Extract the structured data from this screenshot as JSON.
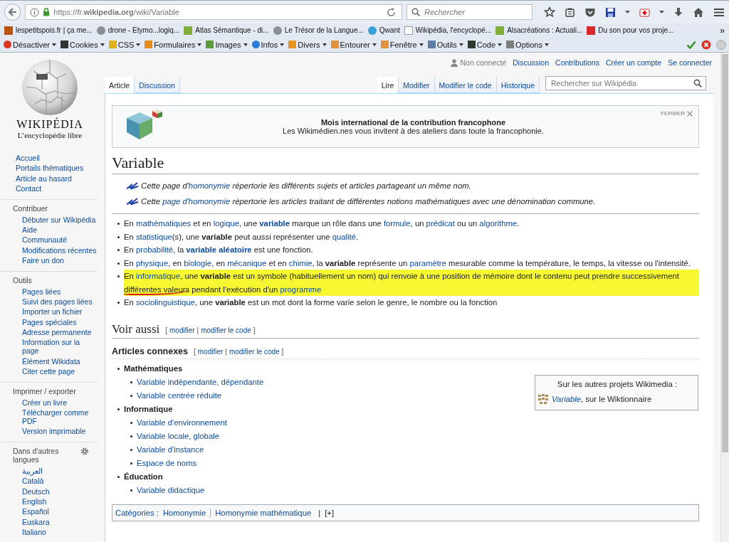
{
  "browser": {
    "url": "https://fr.**wikipedia.org**/wiki/Variable",
    "search_placeholder": "Rechercher",
    "bookmarks": [
      {
        "label": "lespetitspois.fr | ça me...",
        "kind": "tile"
      },
      {
        "label": "drone - Etymo...logiq...",
        "kind": "globe"
      },
      {
        "label": "Atlas Sémantique - di...",
        "kind": "sprout"
      },
      {
        "label": "Le Trésor de la Langue...",
        "kind": "globe"
      },
      {
        "label": "Qwant",
        "kind": "ring"
      },
      {
        "label": "Wikipédia, l'encyclopé...",
        "kind": "page"
      },
      {
        "label": "Alsacréations : Actuali...",
        "kind": "sprout"
      },
      {
        "label": "Du son pour vos proje...",
        "kind": "redtile"
      }
    ],
    "bookmarks_more": "»",
    "devtools": [
      {
        "label": "Désactiver",
        "kind": "block"
      },
      {
        "label": "Cookies",
        "kind": "person"
      },
      {
        "label": "CSS",
        "kind": "wand"
      },
      {
        "label": "Formulaires",
        "kind": "form"
      },
      {
        "label": "Images",
        "kind": "image"
      },
      {
        "label": "Infos",
        "kind": "info"
      },
      {
        "label": "Divers",
        "kind": "book"
      },
      {
        "label": "Entourer",
        "kind": "pencil"
      },
      {
        "label": "Fenêtre",
        "kind": "pencil"
      },
      {
        "label": "Outils",
        "kind": "tools"
      },
      {
        "label": "Code",
        "kind": "terminal"
      },
      {
        "label": "Options",
        "kind": "ruler"
      }
    ]
  },
  "sidebar": {
    "wordmark": "WIKIPÉDIA",
    "tagline": "L’encyclopédie libre",
    "groups": [
      {
        "items": [
          "Accueil",
          "Portails thématiques",
          "Article au hasard",
          "Contact"
        ]
      },
      {
        "heading": "Contribuer",
        "items": [
          "Débuter sur Wikipédia",
          "Aide",
          "Communauté",
          "Modifications récentes",
          "Faire un don"
        ]
      },
      {
        "heading": "Outils",
        "items": [
          "Pages liées",
          "Suivi des pages liées",
          "Importer un fichier",
          "Pages spéciales",
          "Adresse permanente",
          "Information sur la page",
          "Élément Wikidata",
          "Citer cette page"
        ]
      },
      {
        "heading": "Imprimer / exporter",
        "items": [
          "Créer un livre",
          "Télécharger comme PDF",
          "Version imprimable"
        ]
      },
      {
        "heading": "Dans d'autres langues",
        "gear": true,
        "items": [
          "العربية",
          "Català",
          "Deutsch",
          "English",
          "Español",
          "Euskara",
          "Italiano"
        ]
      }
    ]
  },
  "personal": {
    "status": "Non connecté",
    "links": [
      "Discussion",
      "Contributions",
      "Créer un compte",
      "Se connecter"
    ]
  },
  "tabs_left": [
    {
      "label": "Article",
      "selected": true
    },
    {
      "label": "Discussion",
      "selected": false
    }
  ],
  "tabs_right": [
    {
      "label": "Lire",
      "selected": true
    },
    {
      "label": "Modifier",
      "selected": false
    },
    {
      "label": "Modifier le code",
      "selected": false
    },
    {
      "label": "Historique",
      "selected": false
    }
  ],
  "search": {
    "placeholder": "Rechercher sur Wikipédia"
  },
  "banner": {
    "title": "Mois international de la contribution francophone",
    "text": "Les Wikimédien.nes vous invitent à des ateliers dans toute la francophonie.",
    "close": "FERMER"
  },
  "title": "Variable",
  "hatnotes": [
    [
      {
        "t": "Cette page d'"
      },
      {
        "t": "homonymie",
        "link": true
      },
      {
        "t": " répertorie les différents sujets et articles partageant un même nom."
      }
    ],
    [
      {
        "t": "Cette "
      },
      {
        "t": "page d'homonymie",
        "link": true
      },
      {
        "t": " répertorie les articles traitant de différentes notions mathématiques avec une dénomination commune."
      }
    ]
  ],
  "bullets": [
    {
      "highlighted": false,
      "segments": [
        {
          "t": "En "
        },
        {
          "t": "mathématiques",
          "link": true
        },
        {
          "t": " et en "
        },
        {
          "t": "logique",
          "link": true
        },
        {
          "t": ", une "
        },
        {
          "t": "**variable**",
          "link": true
        },
        {
          "t": " marque un rôle dans une "
        },
        {
          "t": "formule",
          "link": true
        },
        {
          "t": ", un "
        },
        {
          "t": "prédicat",
          "link": true
        },
        {
          "t": " ou un "
        },
        {
          "t": "algorithme",
          "link": true
        },
        {
          "t": "."
        }
      ]
    },
    {
      "highlighted": false,
      "segments": [
        {
          "t": "En "
        },
        {
          "t": "statistique",
          "link": true
        },
        {
          "t": "(s), une **variable** peut aussi représenter une "
        },
        {
          "t": "qualité",
          "link": true
        },
        {
          "t": "."
        }
      ]
    },
    {
      "highlighted": false,
      "segments": [
        {
          "t": "En "
        },
        {
          "t": "probabilité",
          "link": true
        },
        {
          "t": ", la "
        },
        {
          "t": "**variable aléatoire**",
          "link": true
        },
        {
          "t": " est une fonction."
        }
      ]
    },
    {
      "highlighted": false,
      "segments": [
        {
          "t": "En "
        },
        {
          "t": "physique",
          "link": true
        },
        {
          "t": ", en "
        },
        {
          "t": "biologie",
          "link": true
        },
        {
          "t": ", en "
        },
        {
          "t": "mécanique",
          "link": true
        },
        {
          "t": " et en "
        },
        {
          "t": "chimie",
          "link": true
        },
        {
          "t": ", la **variable** représente un "
        },
        {
          "t": "paramètre",
          "link": true
        },
        {
          "t": " mesurable comme la température, le temps, la vitesse ou l'intensité."
        }
      ]
    },
    {
      "highlighted": true,
      "segments": [
        {
          "t": "En "
        },
        {
          "t": "informatique",
          "link": true
        },
        {
          "t": ", une **variable** est un symbole (habituellement un nom) qui renvoie à une position de mémoire dont le contenu peut prendre successivement "
        },
        {
          "t": "différentes valeurs",
          "underlined": true
        },
        {
          "t": " pendant l'exécution d'un "
        },
        {
          "t": "programme",
          "link": true
        }
      ]
    },
    {
      "highlighted": false,
      "segments": [
        {
          "t": "En "
        },
        {
          "t": "sociolinguistique",
          "link": true
        },
        {
          "t": ", une **variable** est un mot dont la forme varie selon le genre, le nombre ou la fonction"
        }
      ]
    }
  ],
  "see_also": {
    "title": "Voir aussi",
    "open": "[",
    "sep": "|",
    "close": "]",
    "edit": [
      "modifier",
      "modifier le code"
    ]
  },
  "related": {
    "title": "Articles connexes",
    "open": "[",
    "sep": "|",
    "close": "]",
    "edit": [
      "modifier",
      "modifier le code"
    ],
    "groups": [
      {
        "label": "Mathématiques",
        "children": [
          "Variable indépendante, dépendante",
          "Variable centrée réduite"
        ]
      },
      {
        "label": "Informatique",
        "children": [
          "Variable d'environnement",
          "Variable locale, globale",
          "Variable d'instance",
          "Espace de noms"
        ]
      },
      {
        "label": "Éducation",
        "children": [
          "Variable didactique"
        ]
      }
    ]
  },
  "sister": {
    "title": "Sur les autres projets Wikimedia :",
    "link": "Variable",
    "text": ", sur le Wiktionnaire"
  },
  "categories": {
    "label": "Catégories",
    "colon": " :",
    "items": [
      "Homonymie",
      "Homonymie mathématique"
    ],
    "sep": "|",
    "more": "[+]"
  }
}
